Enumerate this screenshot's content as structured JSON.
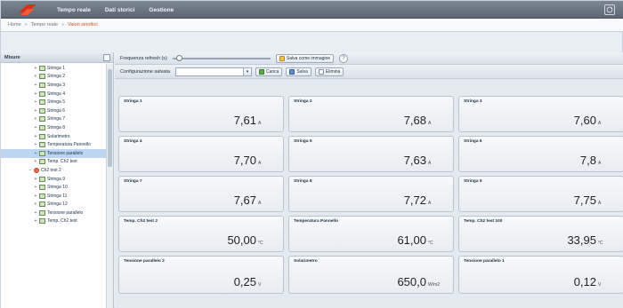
{
  "menu": {
    "items": [
      "Tempo reale",
      "Dati storici",
      "Gestione"
    ]
  },
  "breadcrumb": [
    "Home",
    "Tempo reale",
    "Valori sinottici"
  ],
  "sidebar": {
    "title": "Misure",
    "items": [
      {
        "label": "Stringa 1",
        "selected": false
      },
      {
        "label": "Stringa 2",
        "selected": false
      },
      {
        "label": "Stringa 3",
        "selected": false
      },
      {
        "label": "Stringa 4",
        "selected": false
      },
      {
        "label": "Stringa 5",
        "selected": false
      },
      {
        "label": "Stringa 6",
        "selected": false
      },
      {
        "label": "Stringa 7",
        "selected": false
      },
      {
        "label": "Stringa 8",
        "selected": false
      },
      {
        "label": "Solarimetro",
        "selected": false
      },
      {
        "label": "Temperatura Pannello",
        "selected": false
      },
      {
        "label": "Tensione parallelo",
        "selected": true
      },
      {
        "label": "Temp. Ch2 test",
        "selected": false
      },
      {
        "label": "Ch2 test 2",
        "selected": false,
        "group": true
      },
      {
        "label": "Stringa 9",
        "selected": false
      },
      {
        "label": "Stringa 10",
        "selected": false
      },
      {
        "label": "Stringa 11",
        "selected": false
      },
      {
        "label": "Stringa 12",
        "selected": false
      },
      {
        "label": "Tensione parallelo",
        "selected": false
      },
      {
        "label": "Temp. Ch2 test",
        "selected": false
      }
    ]
  },
  "toolbar": {
    "refresh_label": "Frequenza refresh (s)",
    "save_image_label": "Salva come immagine",
    "help_label": "?",
    "config_label": "Configurazione salvata",
    "config_value": "",
    "load_label": "Carica",
    "save_label": "Salva",
    "delete_label": "Elimina"
  },
  "cards": [
    {
      "title": "Stringa 1",
      "value": "7,61",
      "unit": "A"
    },
    {
      "title": "Stringa 2",
      "value": "7,68",
      "unit": "A"
    },
    {
      "title": "Stringa 3",
      "value": "7,60",
      "unit": "A"
    },
    {
      "title": "Stringa 4",
      "value": "7,70",
      "unit": "A"
    },
    {
      "title": "Stringa 5",
      "value": "7,63",
      "unit": "A"
    },
    {
      "title": "Stringa 6",
      "value": "7,8",
      "unit": "A"
    },
    {
      "title": "Stringa 7",
      "value": "7,67",
      "unit": "A"
    },
    {
      "title": "Stringa 8",
      "value": "7,72",
      "unit": "A"
    },
    {
      "title": "Stringa 9",
      "value": "7,75",
      "unit": "A"
    },
    {
      "title": "Temp. Ch2 test 2",
      "value": "50,00",
      "unit": "°C"
    },
    {
      "title": "Temperatura Pannello",
      "value": "61,00",
      "unit": "°C"
    },
    {
      "title": "Temp. Ch2 test 100",
      "value": "33,95",
      "unit": "°C"
    },
    {
      "title": "Tensione parallelo 2",
      "value": "0,25",
      "unit": "V"
    },
    {
      "title": "Solarimetro",
      "value": "650,0",
      "unit": "W/m2"
    },
    {
      "title": "Tensione parallelo 1",
      "value": "0,12",
      "unit": "V"
    }
  ]
}
